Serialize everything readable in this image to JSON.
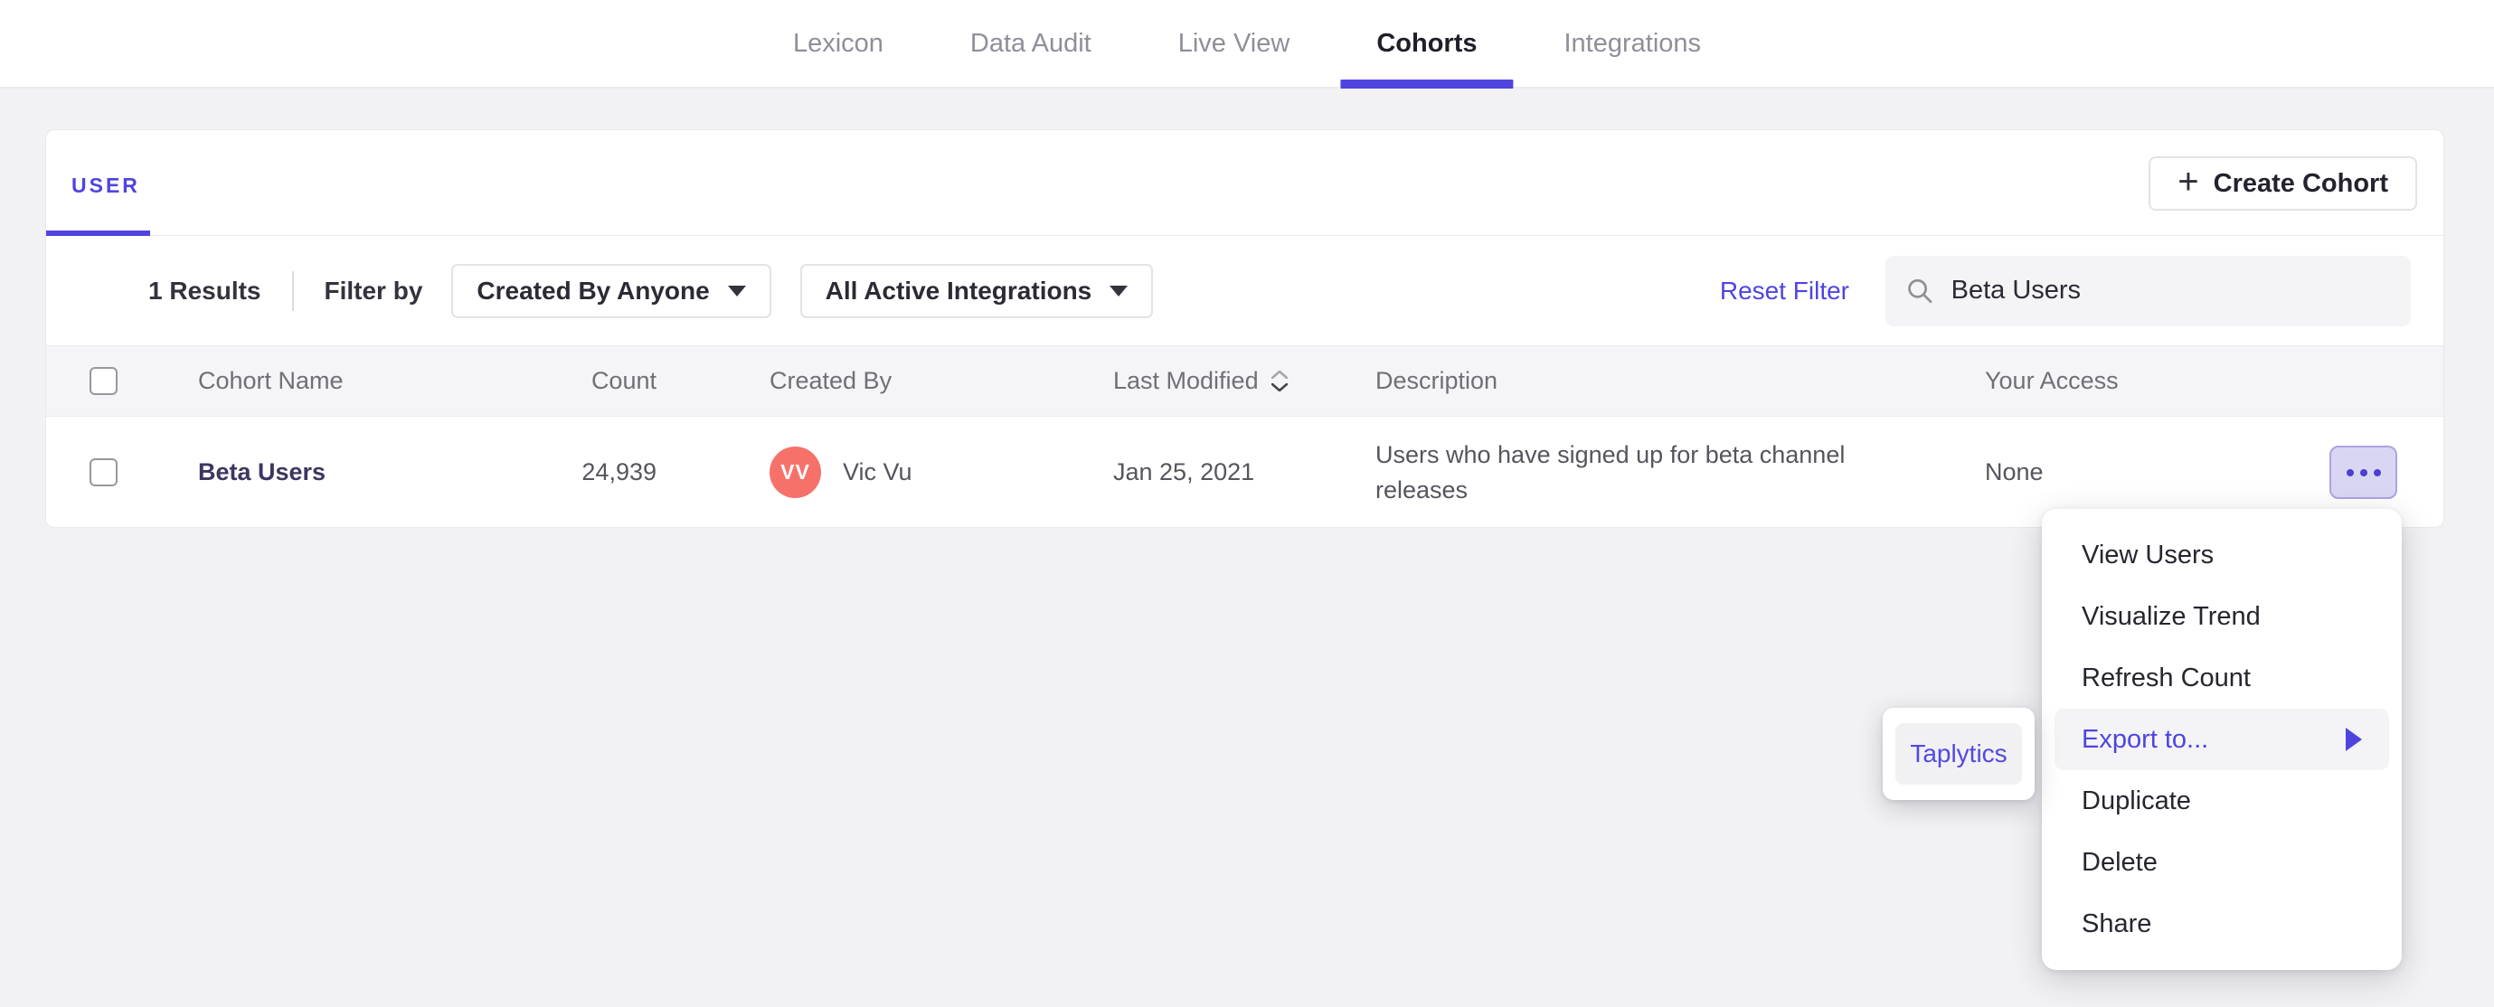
{
  "colors": {
    "accent_purple": "#4f44e0",
    "avatar_coral": "#f7716b",
    "more_button_bg": "#d9d6f4",
    "page_bg": "#f2f2f4",
    "table_header_bg": "#f5f5f7"
  },
  "nav": {
    "tabs": [
      {
        "label": "Lexicon",
        "active": false
      },
      {
        "label": "Data Audit",
        "active": false
      },
      {
        "label": "Live View",
        "active": false
      },
      {
        "label": "Cohorts",
        "active": true
      },
      {
        "label": "Integrations",
        "active": false
      }
    ]
  },
  "panel": {
    "tab_label": "USER",
    "create_button": {
      "plus": "+",
      "label": "Create Cohort"
    },
    "filter_bar": {
      "results_count": "1 Results",
      "filter_by_label": "Filter by",
      "created_by_dropdown": "Created By Anyone",
      "integrations_dropdown": "All Active Integrations",
      "reset_filter_label": "Reset Filter",
      "search_value": "Beta Users"
    },
    "table": {
      "headers": {
        "name": "Cohort Name",
        "count": "Count",
        "created_by": "Created By",
        "last_modified": "Last Modified",
        "description": "Description",
        "your_access": "Your Access"
      },
      "rows": [
        {
          "name": "Beta Users",
          "count": "24,939",
          "avatar_initials": "VV",
          "created_by": "Vic Vu",
          "last_modified": "Jan 25, 2021",
          "description": "Users who have signed up for beta channel releases",
          "access": "None"
        }
      ]
    }
  },
  "context_menu": {
    "items": [
      {
        "label": "View Users"
      },
      {
        "label": "Visualize Trend"
      },
      {
        "label": "Refresh Count"
      },
      {
        "label": "Export to...",
        "highlighted": true
      },
      {
        "label": "Duplicate"
      },
      {
        "label": "Delete"
      },
      {
        "label": "Share"
      }
    ]
  },
  "export_submenu": {
    "items": [
      {
        "label": "Taplytics"
      }
    ]
  }
}
